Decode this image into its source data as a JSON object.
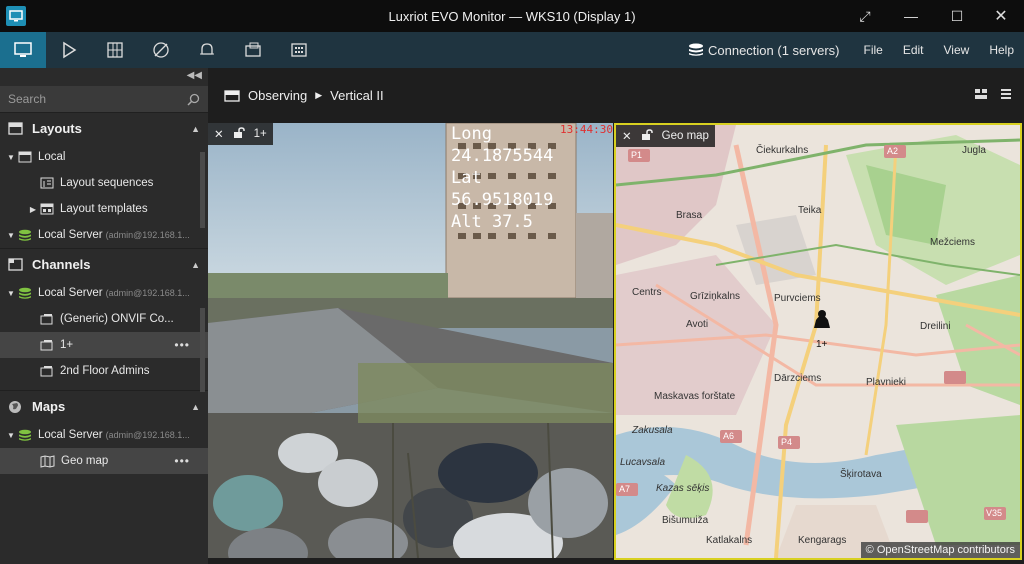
{
  "window": {
    "title": "Luxriot EVO Monitor — WKS10 (Display 1)"
  },
  "menu": {
    "connection": "Connection (1 servers)",
    "file": "File",
    "edit": "Edit",
    "view": "View",
    "help": "Help"
  },
  "sidebar": {
    "search_placeholder": "Search",
    "layouts": {
      "title": "Layouts",
      "local": "Local",
      "layout_sequences": "Layout sequences",
      "layout_templates": "Layout templates",
      "server": "Local Server",
      "server_user": "(admin@192.168.1..."
    },
    "channels": {
      "title": "Channels",
      "server": "Local Server",
      "server_user": "(admin@192.168.1...",
      "items": [
        "(Generic) ONVIF Co...",
        "1+",
        "2nd Floor Admins"
      ]
    },
    "maps": {
      "title": "Maps",
      "server": "Local Server",
      "server_user": "(admin@192.168.1...",
      "geo_map": "Geo map"
    }
  },
  "breadcrumb": {
    "root": "Observing",
    "current": "Vertical II"
  },
  "cam_cell": {
    "label": "1+",
    "osd": "Long\n24.1875544\nLat\n56.9518019\nAlt 37.5",
    "time": "13:44:30"
  },
  "map_cell": {
    "label": "Geo map",
    "marker_label": "1+",
    "copyright": "© OpenStreetMap contributors",
    "places": [
      "Čiekurkalns",
      "Jugla",
      "Brasa",
      "Teika",
      "Mežciems",
      "Centrs",
      "Grīziņkalns",
      "Purvciems",
      "Avoti",
      "Dreilini",
      "Dārzciems",
      "Plavnieki",
      "Maskavas forštate",
      "Zakusala",
      "Lucavsala",
      "Kazas sēķis",
      "Šķirotava",
      "Bišumuiža",
      "Katlakalns",
      "Kengarags",
      "P1",
      "A2",
      "A6",
      "P4",
      "A7",
      "V35"
    ]
  }
}
